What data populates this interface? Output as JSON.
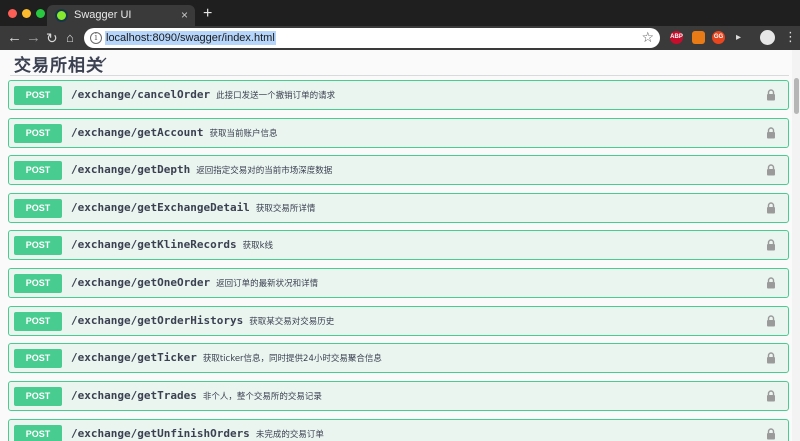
{
  "browser": {
    "tab_title": "Swagger UI",
    "tab_close": "×",
    "new_tab": "+",
    "url": "localhost:8090/swagger/index.html",
    "icons": {
      "back": "←",
      "forward": "→",
      "reload": "↻",
      "home": "⌂",
      "info": "i",
      "star": "☆",
      "menu": "⋮"
    },
    "extensions": [
      "ABP",
      "",
      "GG",
      "▸"
    ]
  },
  "section": {
    "title": "交易所相关"
  },
  "operations": [
    {
      "method": "POST",
      "path": "/exchange/cancelOrder",
      "summary": "此接口发送一个撤销订单的请求"
    },
    {
      "method": "POST",
      "path": "/exchange/getAccount",
      "summary": "获取当前账户信息"
    },
    {
      "method": "POST",
      "path": "/exchange/getDepth",
      "summary": "返回指定交易对的当前市场深度数据"
    },
    {
      "method": "POST",
      "path": "/exchange/getExchangeDetail",
      "summary": "获取交易所详情"
    },
    {
      "method": "POST",
      "path": "/exchange/getKlineRecords",
      "summary": "获取k线"
    },
    {
      "method": "POST",
      "path": "/exchange/getOneOrder",
      "summary": "返回订单的最新状况和详情"
    },
    {
      "method": "POST",
      "path": "/exchange/getOrderHistorys",
      "summary": "获取某交易对交易历史"
    },
    {
      "method": "POST",
      "path": "/exchange/getTicker",
      "summary": "获取ticker信息，同时提供24小时交易聚合信息"
    },
    {
      "method": "POST",
      "path": "/exchange/getTrades",
      "summary": "非个人，整个交易所的交易记录"
    },
    {
      "method": "POST",
      "path": "/exchange/getUnfinishOrders",
      "summary": "未完成的交易订单"
    }
  ],
  "colors": {
    "post": "#49cc90",
    "post_bg": "#ebf5f0",
    "text": "#3b4151"
  }
}
